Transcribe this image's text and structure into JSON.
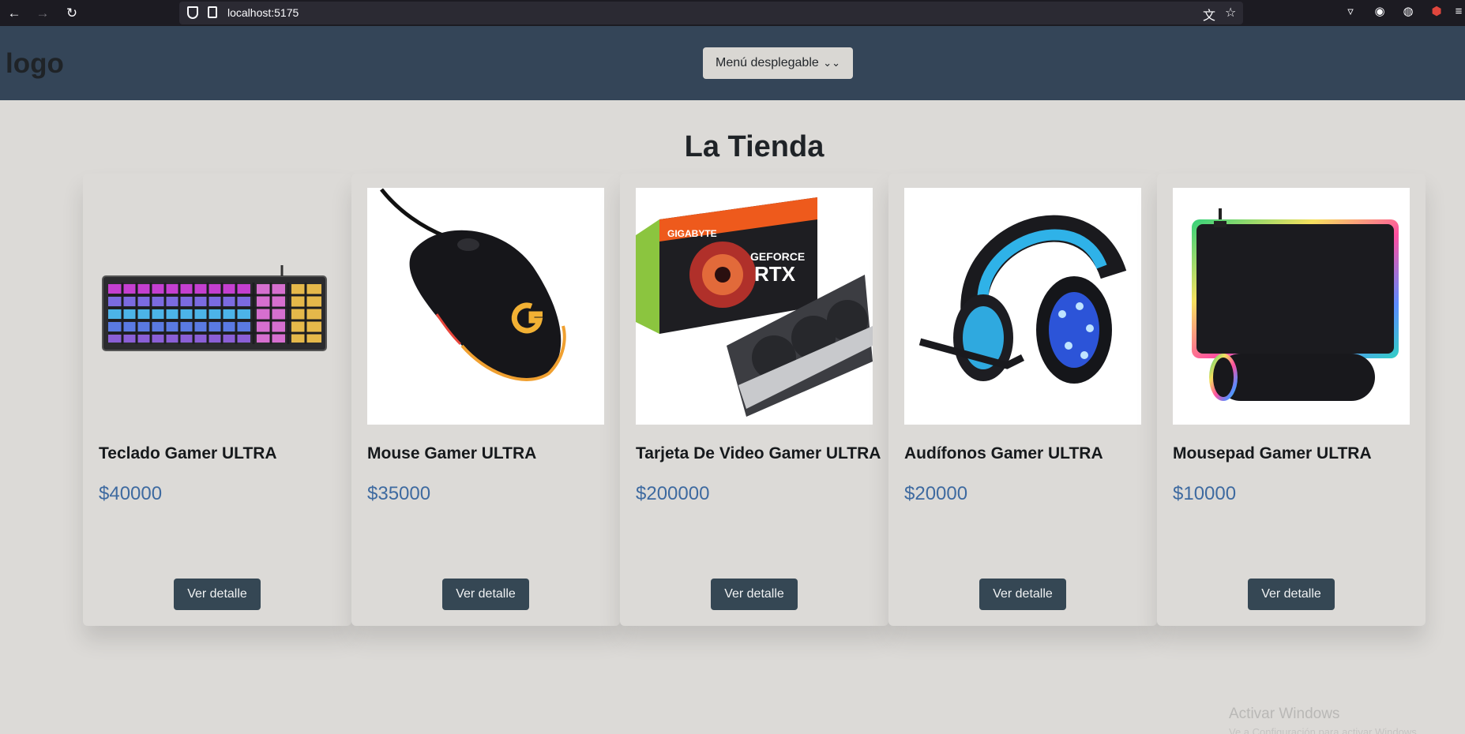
{
  "browser": {
    "url": "localhost:5175"
  },
  "header": {
    "logo": "logo",
    "menu_label": "Menú desplegable"
  },
  "store": {
    "title": "La Tienda",
    "products": [
      {
        "name": "Teclado Gamer ULTRA",
        "price": "$40000",
        "button": "Ver detalle"
      },
      {
        "name": "Mouse Gamer ULTRA",
        "price": "$35000",
        "button": "Ver detalle"
      },
      {
        "name": "Tarjeta De Video Gamer ULTRA",
        "price": "$200000",
        "button": "Ver detalle"
      },
      {
        "name": "Audífonos Gamer ULTRA",
        "price": "$20000",
        "button": "Ver detalle"
      },
      {
        "name": "Mousepad Gamer ULTRA",
        "price": "$10000",
        "button": "Ver detalle"
      }
    ]
  },
  "os": {
    "watermark": "Activar Windows",
    "watermark_sub": "Ve a Configuración para activar Windows."
  },
  "colors": {
    "header_bg": "#344558",
    "page_bg": "#dcdad7",
    "button_bg": "#354754",
    "price": "#3e6aa0"
  }
}
